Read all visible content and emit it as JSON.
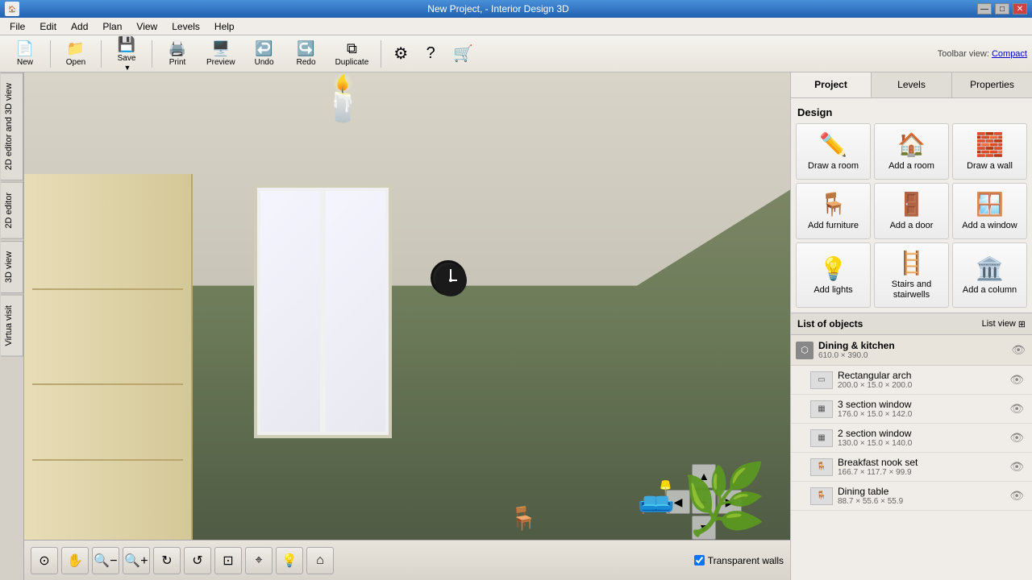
{
  "titlebar": {
    "title": "New Project, - Interior Design 3D",
    "minimize": "—",
    "maximize": "□",
    "close": "✕"
  },
  "menubar": {
    "items": [
      "File",
      "Edit",
      "Add",
      "Plan",
      "View",
      "Levels",
      "Help"
    ]
  },
  "toolbar": {
    "buttons": [
      {
        "label": "New",
        "icon": "📄"
      },
      {
        "label": "Open",
        "icon": "📁"
      },
      {
        "label": "Save",
        "icon": "💾"
      },
      {
        "label": "Print",
        "icon": "🖨️"
      },
      {
        "label": "Preview",
        "icon": "🖥️"
      },
      {
        "label": "Undo",
        "icon": "↩️"
      },
      {
        "label": "Redo",
        "icon": "↪️"
      },
      {
        "label": "Duplicate",
        "icon": "⧉"
      }
    ],
    "toolbar_view_label": "Toolbar view:",
    "toolbar_view_compact": "Compact",
    "settings_icon": "⚙",
    "help_icon": "?",
    "cart_icon": "🛒"
  },
  "side_tabs": [
    {
      "label": "2D editor and 3D view",
      "id": "2d-3d-view"
    },
    {
      "label": "2D editor",
      "id": "2d-editor"
    },
    {
      "label": "3D view",
      "id": "3d-view"
    },
    {
      "label": "Virtua visit",
      "id": "virtual-visit"
    }
  ],
  "bottom_toolbar": {
    "buttons": [
      {
        "icon": "⊙",
        "name": "360-view-btn"
      },
      {
        "icon": "✋",
        "name": "pan-btn"
      },
      {
        "icon": "🔍−",
        "name": "zoom-out-btn"
      },
      {
        "icon": "🔍+",
        "name": "zoom-in-btn"
      },
      {
        "icon": "↻",
        "name": "rotate-left-btn"
      },
      {
        "icon": "↺",
        "name": "rotate-right-btn"
      },
      {
        "icon": "⊡",
        "name": "orbit-btn"
      },
      {
        "icon": "⌖",
        "name": "look-btn"
      },
      {
        "icon": "💡",
        "name": "light-btn"
      },
      {
        "icon": "⌂",
        "name": "home-btn"
      }
    ],
    "transparent_walls_label": "Transparent walls",
    "transparent_walls_checked": true
  },
  "right_panel": {
    "tabs": [
      {
        "label": "Project",
        "id": "project-tab",
        "active": true
      },
      {
        "label": "Levels",
        "id": "levels-tab",
        "active": false
      },
      {
        "label": "Properties",
        "id": "properties-tab",
        "active": false
      }
    ],
    "design": {
      "header": "Design",
      "buttons": [
        {
          "label": "Draw a room",
          "icon": "✏️",
          "id": "draw-room"
        },
        {
          "label": "Add a room",
          "icon": "🏠",
          "id": "add-room"
        },
        {
          "label": "Draw a wall",
          "icon": "🧱",
          "id": "draw-wall"
        },
        {
          "label": "Add furniture",
          "icon": "🪑",
          "id": "add-furniture"
        },
        {
          "label": "Add a door",
          "icon": "🚪",
          "id": "add-door"
        },
        {
          "label": "Add a window",
          "icon": "🪟",
          "id": "add-window"
        },
        {
          "label": "Add lights",
          "icon": "💡",
          "id": "add-lights"
        },
        {
          "label": "Stairs and stairwells",
          "icon": "🪜",
          "id": "stairs"
        },
        {
          "label": "Add a column",
          "icon": "🏛️",
          "id": "add-column"
        }
      ]
    },
    "list_of_objects": {
      "header": "List of objects",
      "list_view": "List view",
      "group": {
        "name": "Dining & kitchen",
        "dims": "610.0 × 390.0",
        "icon": "⬡"
      },
      "items": [
        {
          "name": "Rectangular arch",
          "dims": "200.0 × 15.0 × 200.0",
          "icon": "▭"
        },
        {
          "name": "3 section window",
          "dims": "176.0 × 15.0 × 142.0",
          "icon": "▦"
        },
        {
          "name": "2 section window",
          "dims": "130.0 × 15.0 × 140.0",
          "icon": "▦"
        },
        {
          "name": "Breakfast nook set",
          "dims": "166.7 × 117.7 × 99.9",
          "icon": "🪑"
        },
        {
          "name": "Dining table",
          "dims": "88.7 × 55.6 × 55.9",
          "icon": "🪑"
        }
      ]
    }
  },
  "scene": {
    "nav": {
      "up": "▲",
      "down": "▼",
      "left": "◀",
      "right": "▶",
      "center": "+"
    }
  }
}
